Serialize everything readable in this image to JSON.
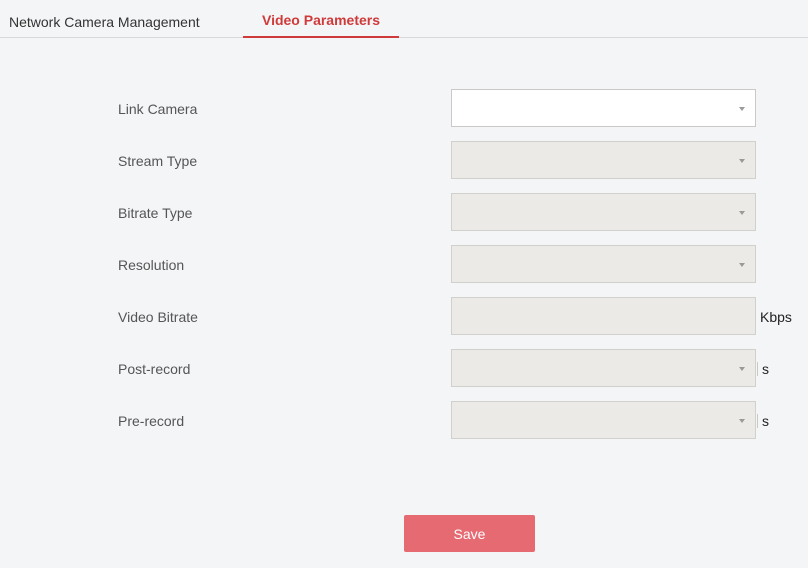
{
  "tabs": [
    {
      "label": "Network Camera Management",
      "active": false
    },
    {
      "label": "Video Parameters",
      "active": true
    }
  ],
  "form": {
    "link_camera": {
      "label": "Link Camera",
      "value": "",
      "enabled": true
    },
    "stream_type": {
      "label": "Stream Type",
      "value": "",
      "enabled": false
    },
    "bitrate_type": {
      "label": "Bitrate Type",
      "value": "",
      "enabled": false
    },
    "resolution": {
      "label": "Resolution",
      "value": "",
      "enabled": false
    },
    "video_bitrate": {
      "label": "Video Bitrate",
      "value": "",
      "unit": "Kbps",
      "enabled": false
    },
    "post_record": {
      "label": "Post-record",
      "value": "",
      "unit": "s",
      "enabled": false
    },
    "pre_record": {
      "label": "Pre-record",
      "value": "",
      "unit": "s",
      "enabled": false
    }
  },
  "actions": {
    "save_label": "Save"
  },
  "colors": {
    "accent": "#cf3a3a",
    "save_button": "#e66a72",
    "disabled_field": "#ebeae6",
    "background": "#f4f5f7"
  }
}
